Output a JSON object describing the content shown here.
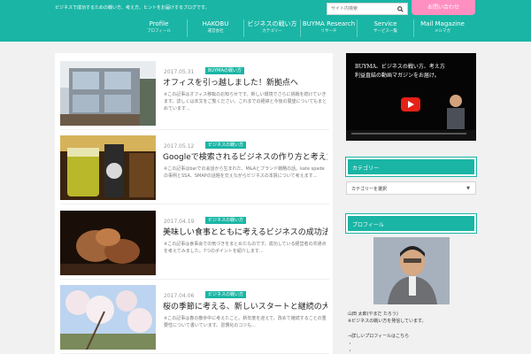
{
  "header": {
    "tagline": "ビジネスで成功するための戦い方、考え方、ヒントをお届けするブログです。",
    "search_placeholder": "サイト内検索",
    "cta_label": "お問い合わせ"
  },
  "nav": [
    {
      "label": "Profile",
      "sub": "プロフィール"
    },
    {
      "label": "HAKOBU",
      "sub": "運営会社"
    },
    {
      "label": "ビジネスの戦い方",
      "sub": "カテゴリー"
    },
    {
      "label": "BUYMA Research",
      "sub": "リサーチ"
    },
    {
      "label": "Service",
      "sub": "サービス一覧"
    },
    {
      "label": "Mail Magazine",
      "sub": "メルマガ"
    }
  ],
  "articles": [
    {
      "date": "2017.05.31",
      "category": "BUYMAの戦い方",
      "title": "オフィスを引っ越しました！新拠点へ",
      "excerpt": "※この記事はオフィス移転のお知らせです。新しい環境でさらに挑戦を続けていきます。詳しくは本文をご覧ください。これまでの経緯と今後の展望についてもまとめています..."
    },
    {
      "date": "2017.05.12",
      "category": "ビジネスの戦い方",
      "title": "Googleで検索されるビジネスの作り方と考え方",
      "excerpt": "※この記事はbarでの会話から生まれた、M&Aとブランド戦略の話。kate spadeの事例とSSA、SMAPの話題を交えながらビジネスの本質について考えます..."
    },
    {
      "date": "2017.04.19",
      "category": "ビジネスの戦い方",
      "title": "美味しい食事とともに考えるビジネスの成功法則とは",
      "excerpt": "※この記事は食事会での気づきをまとめたものです。成功している経営者の共通点を考えてみました。7つのポイントを紹介します..."
    },
    {
      "date": "2017.04.06",
      "category": "ビジネスの戦い方",
      "title": "桜の季節に考える、新しいスタートと継続の大切さについて",
      "excerpt": "※この記事は春の散歩中に考えたこと。新年度を迎えて、改めて継続することの重要性について書いています。習慣化のコツも..."
    }
  ],
  "sidebar": {
    "video_line1": "BUYMA、ビジネスの戦い方、考え方",
    "video_line2": "利益直結の動画マガジンをお届け。",
    "category_widget_title": "カテゴリー",
    "category_select_value": "カテゴリーを選択",
    "profile_widget_title": "プロフィール",
    "profile_name": "山田 太郎(やまだ たろう)",
    "profile_line1": "※ビジネスの戦い方を発信しています。",
    "profile_line2": "→詳しいプロフィールはこちら",
    "profile_line3": "・",
    "profile_line4": "・"
  },
  "colors": {
    "accent": "#1ab5a5",
    "cta": "#ff8fc1",
    "background": "#f1f1f1"
  },
  "icons": {
    "search": "search-icon",
    "play": "play-icon",
    "dropdown": "chevron-down-icon"
  }
}
